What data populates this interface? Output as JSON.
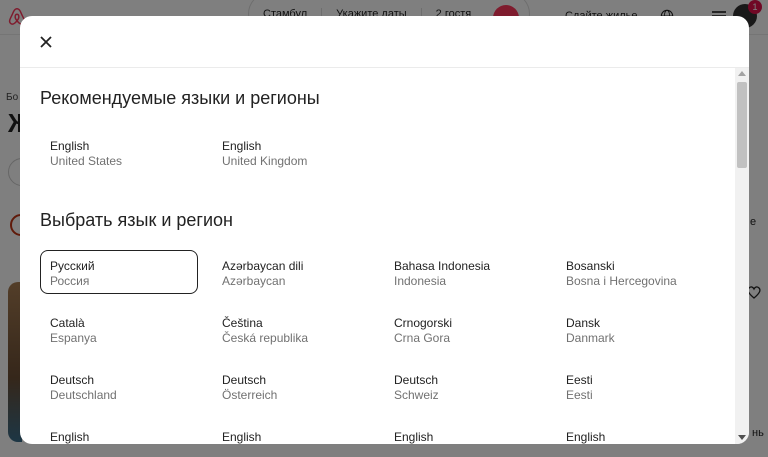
{
  "background": {
    "search_segments": [
      "Стамбул",
      "Укажите даты",
      "2 гостя"
    ],
    "host_link": "Сдайте жилье",
    "notification_count": "1",
    "crumb": "Бо",
    "title_fragment": "Ж",
    "right_fragment": "е",
    "bottom_fragment": "нь"
  },
  "modal": {
    "close_icon": "close-icon",
    "recommended_title": "Рекомендуемые языки и регионы",
    "recommended": [
      {
        "name": "English",
        "region": "United States"
      },
      {
        "name": "English",
        "region": "United Kingdom"
      }
    ],
    "choose_title": "Выбрать язык и регион",
    "languages": [
      {
        "name": "Русский",
        "region": "Россия",
        "selected": true
      },
      {
        "name": "Azərbaycan dili",
        "region": "Azərbaycan"
      },
      {
        "name": "Bahasa Indonesia",
        "region": "Indonesia"
      },
      {
        "name": "Bosanski",
        "region": "Bosna i Hercegovina"
      },
      {
        "name": "Català",
        "region": "Espanya"
      },
      {
        "name": "Čeština",
        "region": "Česká republika"
      },
      {
        "name": "Crnogorski",
        "region": "Crna Gora"
      },
      {
        "name": "Dansk",
        "region": "Danmark"
      },
      {
        "name": "Deutsch",
        "region": "Deutschland"
      },
      {
        "name": "Deutsch",
        "region": "Österreich"
      },
      {
        "name": "Deutsch",
        "region": "Schweiz"
      },
      {
        "name": "Eesti",
        "region": "Eesti"
      },
      {
        "name": "English",
        "region": ""
      },
      {
        "name": "English",
        "region": ""
      },
      {
        "name": "English",
        "region": ""
      },
      {
        "name": "English",
        "region": ""
      }
    ]
  },
  "colors": {
    "brand": "#ff385c",
    "selected_border": "#222222",
    "secondary_text": "#717171"
  }
}
